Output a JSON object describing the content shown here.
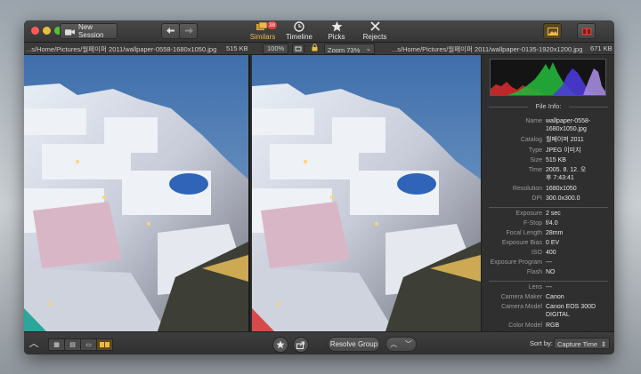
{
  "toolbar": {
    "new_session": "New Session",
    "badge": "38",
    "tools": [
      {
        "label": "Similars",
        "icon": "similars-icon",
        "active": true
      },
      {
        "label": "Timeline",
        "icon": "clock-icon"
      },
      {
        "label": "Picks",
        "icon": "star-icon"
      },
      {
        "label": "Rejects",
        "icon": "x-icon"
      }
    ]
  },
  "infobar": {
    "left_path": "...s/Home/Pictures/월페이퍼 2011/wallpaper-0558-1680x1050.jpg",
    "left_size": "515 KB",
    "zoom_fit": "100%",
    "zoom_select": "Zoom 73%",
    "right_path": "...s/Home/Pictures/월페이퍼 2011/wallpaper-0135-1920x1200.jpg",
    "right_size": "671 KB"
  },
  "sidebar": {
    "file_info_title": "File Info:",
    "file_info": [
      {
        "k": "Name",
        "v": "wallpaper-0558-1680x1050.jpg"
      },
      {
        "k": "Catalog",
        "v": "월페이퍼 2011"
      },
      {
        "k": "Type",
        "v": "JPEG 이미지"
      },
      {
        "k": "Size",
        "v": "515 KB"
      },
      {
        "k": "Time",
        "v": "2005. 8. 12. 오후 7:43:41"
      },
      {
        "k": "Resolution",
        "v": "1680x1050"
      },
      {
        "k": "DPI",
        "v": "300.0x300.0"
      }
    ],
    "exif": [
      {
        "k": "Exposure",
        "v": "2 sec"
      },
      {
        "k": "F-Stop",
        "v": "f/4.0"
      },
      {
        "k": "Focal Length",
        "v": "28mm"
      },
      {
        "k": "Exposure Bias",
        "v": "0 EV"
      },
      {
        "k": "ISO",
        "v": "400"
      },
      {
        "k": "Exposure Program",
        "v": "---"
      },
      {
        "k": "Flash",
        "v": "NO"
      }
    ],
    "lens": [
      {
        "k": "Lens",
        "v": "---"
      },
      {
        "k": "Camera Maker",
        "v": "Canon"
      },
      {
        "k": "Camera Model",
        "v": "Canon EOS 300D DIGITAL"
      },
      {
        "k": "Color Model",
        "v": "RGB"
      }
    ]
  },
  "bottom": {
    "resolve": "Resolve Group",
    "sort_by": "Sort by:",
    "sort_value": "Capture Time"
  }
}
